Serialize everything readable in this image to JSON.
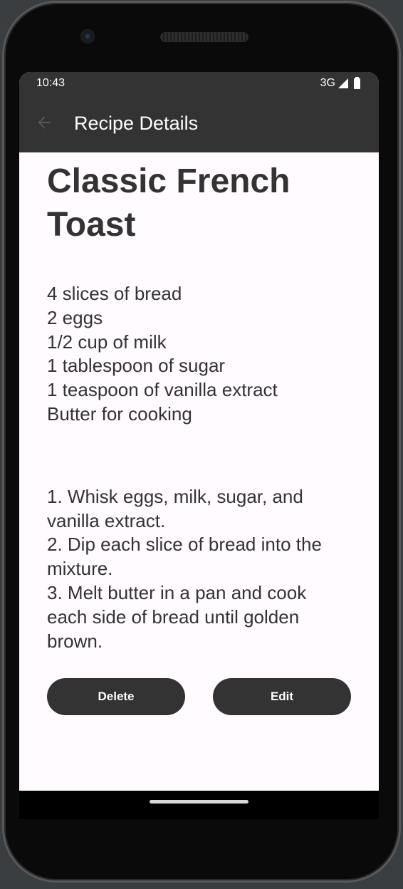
{
  "status_bar": {
    "time": "10:43",
    "network": "3G"
  },
  "app_bar": {
    "title": "Recipe Details",
    "back_icon": "arrow-back-icon"
  },
  "recipe": {
    "title_line1": "Classic French",
    "title_line2": "Toast",
    "ingredients": [
      "4 slices of bread",
      "2 eggs",
      "1/2 cup of milk",
      "1 tablespoon of sugar",
      "1 teaspoon of vanilla extract",
      "Butter for cooking"
    ],
    "steps_lines": [
      "1. Whisk eggs, milk, sugar, and",
      "vanilla extract.",
      "2. Dip each slice of bread into the",
      "mixture.",
      "3. Melt butter in a pan and cook",
      "each side of bread until golden",
      "brown."
    ]
  },
  "actions": {
    "delete_label": "Delete",
    "edit_label": "Edit"
  },
  "colors": {
    "app_bar": "#333333",
    "background": "#fffbfe",
    "button": "#333333",
    "text": "#333333"
  }
}
